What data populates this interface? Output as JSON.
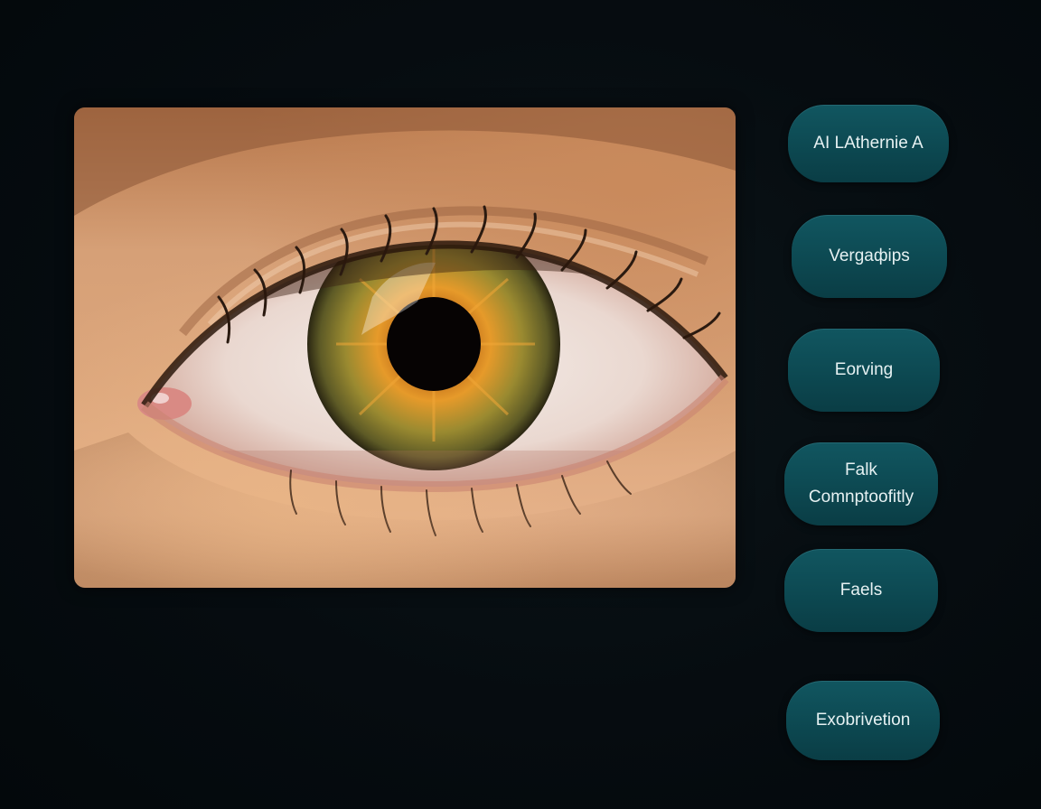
{
  "image": {
    "subject": "eye-photo"
  },
  "menu": {
    "items": [
      {
        "label": "AI LAthernie A"
      },
      {
        "label": "Vergaфips"
      },
      {
        "label": "Eorving"
      },
      {
        "label": "Falk\nComnptoofitly"
      },
      {
        "label": "Faels"
      },
      {
        "label": "Exobrivetion"
      }
    ]
  },
  "colors": {
    "background": "#050b0f",
    "pill": "#0d4a53",
    "pill_text": "#e6f1f2",
    "iris_outer": "#6f6a2a",
    "iris_inner": "#d98a1e"
  }
}
